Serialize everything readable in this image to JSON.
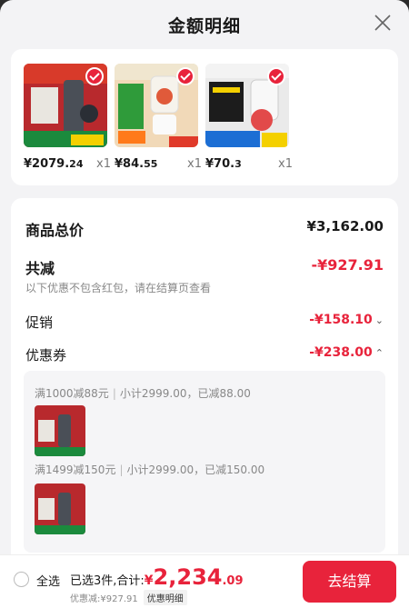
{
  "header": {
    "title": "金额明细"
  },
  "products": [
    {
      "price_main": "¥2079.",
      "price_dec": "24",
      "qty": "x1"
    },
    {
      "price_main": "¥84.",
      "price_dec": "55",
      "qty": "x1"
    },
    {
      "price_main": "¥70.",
      "price_dec": "3",
      "qty": "x1"
    }
  ],
  "summary": {
    "total_label": "商品总价",
    "total_value": "¥3,162.00",
    "discount_label": "共减",
    "discount_value": "-¥927.91",
    "discount_note": "以下优惠不包含红包，请在结算页查看",
    "promo_label": "促销",
    "promo_value": "-¥158.10",
    "coupon_label": "优惠券",
    "coupon_value": "-¥238.00"
  },
  "coupons": [
    {
      "rule": "满1000减88元",
      "detail": "小计2999.00，已减88.00"
    },
    {
      "rule": "满1499减150元",
      "detail": "小计2999.00，已减150.00"
    }
  ],
  "bottom": {
    "select_all": "全选",
    "selected": "已选3件,合计:",
    "currency": "¥",
    "total_int": "2,234",
    "total_dec": ".09",
    "discount_line": "优惠减:¥927.91",
    "detail_link": "优惠明细",
    "checkout": "去结算"
  },
  "colors": {
    "accent": "#e8233b"
  },
  "icons": {
    "close": "close-icon",
    "check": "check-icon",
    "chevron_down": "chevron-down-icon",
    "chevron_up": "chevron-up-icon"
  }
}
